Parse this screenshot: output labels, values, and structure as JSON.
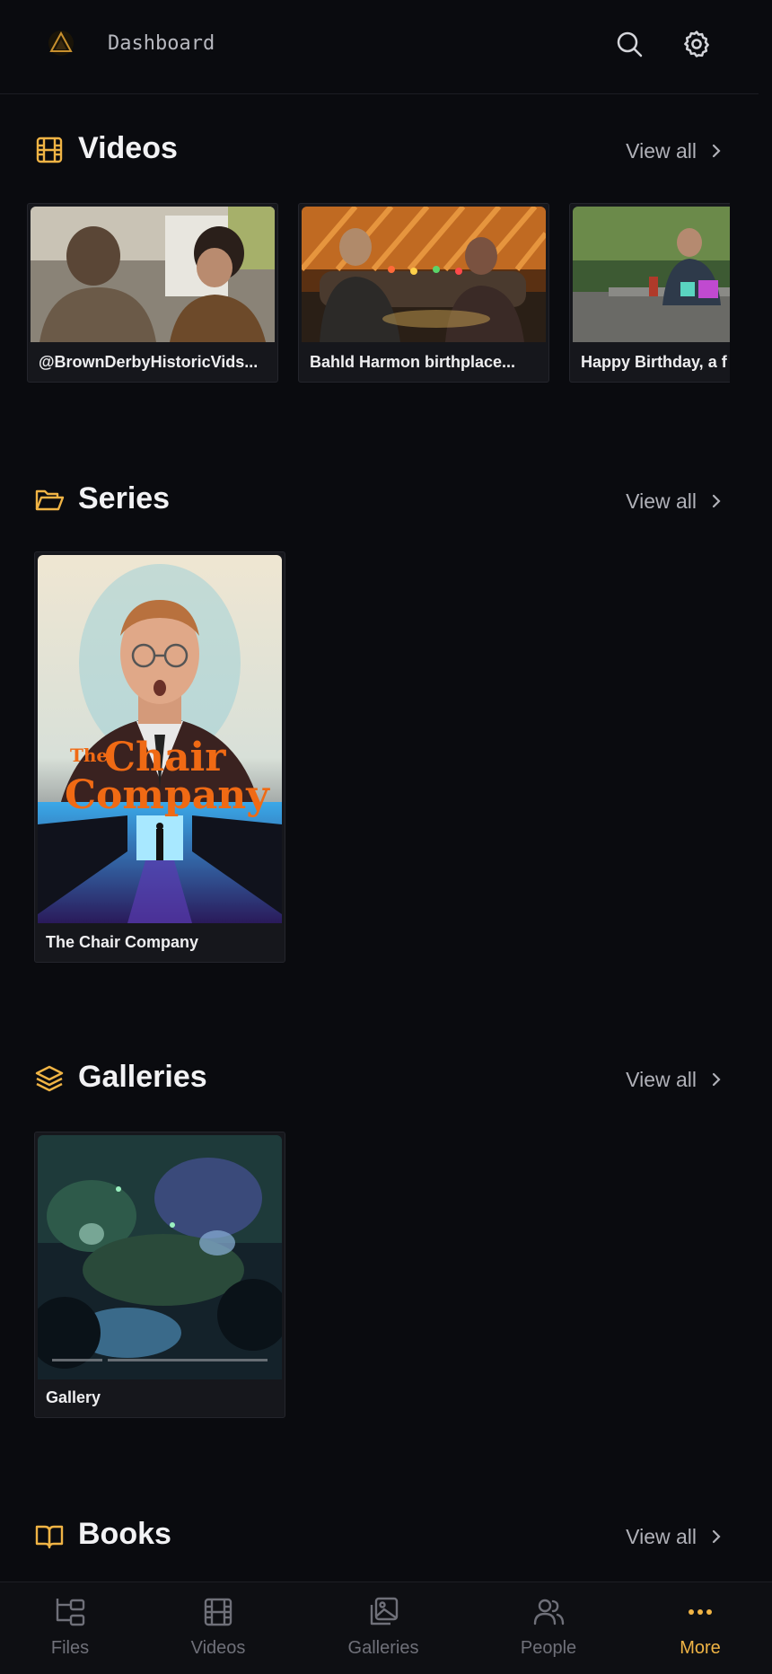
{
  "header": {
    "title": "Dashboard",
    "logo_icon": "app-logo-icon",
    "search_icon": "search-icon",
    "settings_icon": "gear-icon"
  },
  "accent_color": "#f0b445",
  "sections": {
    "videos": {
      "title": "Videos",
      "view_all": "View all",
      "items": [
        {
          "title": "@BrownDerbyHistoricVids..."
        },
        {
          "title": "Bahld Harmon birthplace..."
        },
        {
          "title": "Happy Birthday, a f"
        }
      ]
    },
    "series": {
      "title": "Series",
      "view_all": "View all",
      "items": [
        {
          "title": "The Chair Company",
          "poster_line1": "The",
          "poster_line2": "Chair",
          "poster_line3": "Company"
        }
      ]
    },
    "galleries": {
      "title": "Galleries",
      "view_all": "View all",
      "items": [
        {
          "title": "Gallery"
        }
      ]
    },
    "books": {
      "title": "Books",
      "view_all": "View all"
    }
  },
  "bottom_nav": [
    {
      "label": "Files",
      "icon": "folder-tree-icon"
    },
    {
      "label": "Videos",
      "icon": "film-icon"
    },
    {
      "label": "Galleries",
      "icon": "images-icon"
    },
    {
      "label": "People",
      "icon": "users-icon"
    },
    {
      "label": "More",
      "icon": "more-dots-icon",
      "active": true
    }
  ]
}
